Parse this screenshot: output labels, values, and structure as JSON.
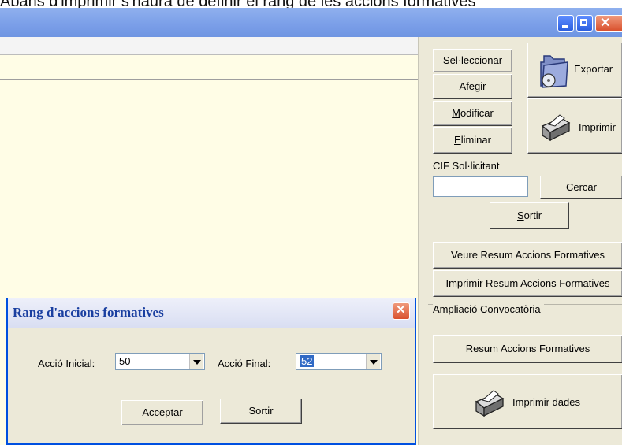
{
  "caption": "Abans d'imprimir s'haurà de definir el rang de les accions formatives",
  "panel": {
    "seleccionar": "Sel·leccionar",
    "afegir": "Afegir",
    "modificar": "Modificar",
    "eliminar": "Eliminar",
    "exportar": "Exportar",
    "imprimir": "Imprimir",
    "cif_label": "CIF Sol·licitant",
    "cif_value": "",
    "cercar": "Cercar",
    "sortir": "Sortir",
    "veure_resum": "Veure Resum Accions Formatives",
    "imprimir_resum": "Imprimir Resum Accions Formatives",
    "ampliacio_label": "Ampliació Convocatòria",
    "resum_accions": "Resum Accions Formatives",
    "imprimir_dades": "Imprimir dades"
  },
  "dialog": {
    "title": "Rang d'accions formatives",
    "accio_inicial_label": "Acció Inicial:",
    "accio_inicial_value": "50",
    "accio_final_label": "Acció Final:",
    "accio_final_value": "52",
    "acceptar": "Acceptar",
    "sortir": "Sortir"
  },
  "colors": {
    "titlebar": "#7a9ee8",
    "panel_bg": "#ece9d8",
    "main_bg": "#fffde6",
    "selection": "#316ac5"
  },
  "icons": [
    "minimize-icon",
    "maximize-icon",
    "close-icon",
    "folder-cd-icon",
    "printer-icon"
  ]
}
